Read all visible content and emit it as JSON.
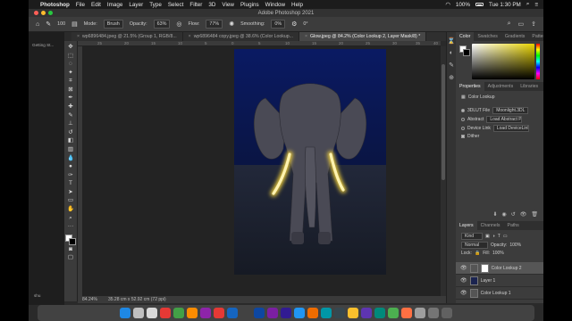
{
  "menubar": {
    "app_name": "Photoshop",
    "items": [
      "File",
      "Edit",
      "Image",
      "Layer",
      "Type",
      "Select",
      "Filter",
      "3D",
      "View",
      "Plugins",
      "Window",
      "Help"
    ],
    "battery": "100%",
    "clock": "Tue 1:30 PM"
  },
  "window": {
    "title": "Adobe Photoshop 2021"
  },
  "options": {
    "mode_label": "Mode:",
    "mode_value": "Brush",
    "opacity_label": "Opacity:",
    "opacity_value": "63%",
    "flow_label": "Flow:",
    "flow_value": "77%",
    "smoothing_label": "Smoothing:",
    "smoothing_value": "0%",
    "angle_value": "0°",
    "brush_size": "100"
  },
  "tabs": [
    {
      "label": "wp6896484.jpeg @ 21.5% (Group 1, RGB/8...",
      "active": false
    },
    {
      "label": "wp6896484 copy.jpeg @ 38.6% (Color Lookup...",
      "active": false
    },
    {
      "label": "Glow.jpeg @ 84.2% (Color Lookup 2, Layer Mask/8) *",
      "active": true
    }
  ],
  "ruler_ticks": [
    "25",
    "20",
    "15",
    "10",
    "5",
    "0",
    "5",
    "10",
    "15",
    "20",
    "25",
    "30",
    "35",
    "40"
  ],
  "status": {
    "zoom": "84.24%",
    "doc_size": "35.28 cm x 52.92 cm (72 ppi)"
  },
  "panels": {
    "color_tabs": [
      "Color",
      "Swatches",
      "Gradients",
      "Patterns"
    ],
    "properties_tabs": [
      "Properties",
      "Adjustments",
      "Libraries"
    ],
    "properties": {
      "heading": "Color Lookup",
      "rows": [
        {
          "label": "3DLUT File",
          "value": "Moonlight.3DL",
          "selected": true
        },
        {
          "label": "Abstract",
          "value": "Load Abstract Profile...",
          "selected": false
        },
        {
          "label": "Device Link",
          "value": "Load DeviceLink Profile...",
          "selected": false
        }
      ],
      "dither_label": "Dither"
    },
    "layers_tabs": [
      "Layers",
      "Channels",
      "Paths"
    ],
    "layers": {
      "kind_label": "Kind",
      "blend_mode": "Normal",
      "opacity_label": "Opacity:",
      "opacity_value": "100%",
      "lock_label": "Lock:",
      "fill_label": "Fill:",
      "fill_value": "100%",
      "items": [
        {
          "name": "Color Lookup 2",
          "active": true
        },
        {
          "name": "Layer 1",
          "active": false
        },
        {
          "name": "Color Lookup 1",
          "active": false
        }
      ]
    }
  },
  "background_windows": {
    "left_tab": "Getting St...",
    "bottom_label": "shu"
  },
  "colors": {
    "accent": "#2d75e8",
    "night_sky": "#0b1a5c",
    "tusk_glow": "#f5d64a"
  }
}
